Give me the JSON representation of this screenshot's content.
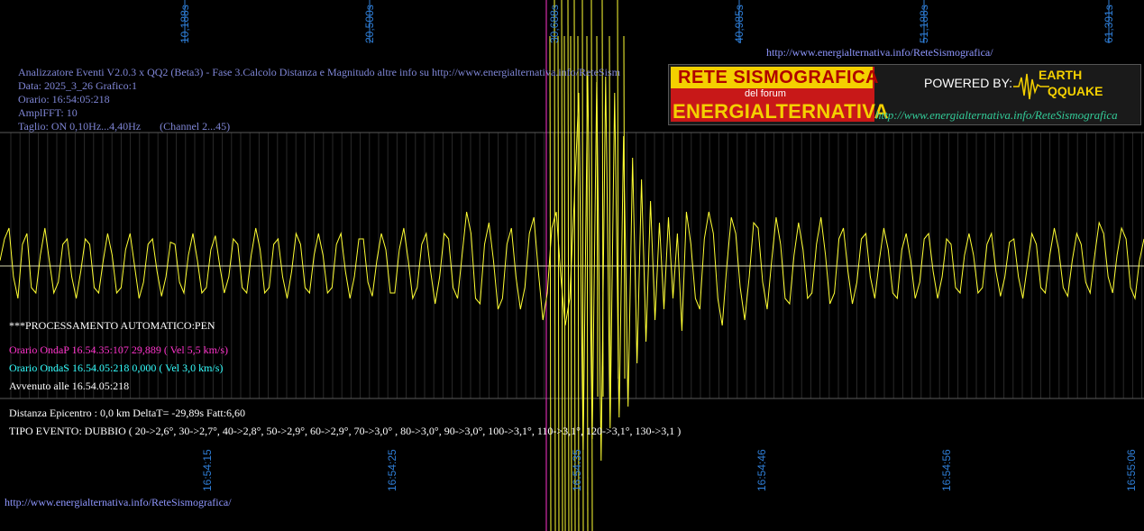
{
  "header": {
    "top_url": "http://www.energialternativa.info/ReteSismografica/",
    "title_line": "Analizzatore Eventi V2.0.3 x QQ2 (Beta3) - Fase 3.Calcolo Distanza e Magnitudo altre info su http://www.energialternativa.info/ReteSism",
    "data_line": "Data: 2025_3_26 Grafico:1",
    "orario_line": "Orario: 16:54:05:218",
    "ampl_line": "AmplFFT: 10",
    "taglio_line": "Taglio: ON 0,10Hz...4,40Hz       (Channel 2...45)"
  },
  "logo": {
    "rete": "RETE SISMOGRAFICA",
    "forum": "del forum",
    "energia": "ENERGIALTERNATIVA",
    "powered": "POWERED BY:",
    "earth": "EARTH",
    "quake": "QQUAKE",
    "url": "http://www.energialternativa.info/ReteSismografica"
  },
  "processing": {
    "status": "***PROCESSAMENTO AUTOMATICO:PEN",
    "onda_p": "Orario OndaP 16.54.35:107  29,889 ( Vel 5,5 km/s)",
    "onda_s": "Orario OndaS 16.54.05:218  0,000 ( Vel 3,0 km/s)",
    "avvenuto": "Avvenuto alle 16.54.05:218",
    "distanza": "Distanza Epicentro : 0,0 km DeltaT= -29,89s  Fatt:6,60",
    "tipo": "TIPO EVENTO: DUBBIO ( 20->2,6°, 30->2,7°, 40->2,8°, 50->2,9°, 60->2,9°, 70->3,0° , 80->3,0°, 90->3,0°, 100->3,1°, 110->3,1°, 120->3,1°, 130->3,1 )"
  },
  "footer_url": "http://www.energialternativa.info/ReteSismografica/",
  "colors": {
    "trace": "#ffff33",
    "grid": "#5a5a5a",
    "baseline": "#d8d8b0",
    "onda_p": "#ff33cc",
    "axis_label": "#2f7fd9"
  },
  "chart_data": {
    "type": "line",
    "xlabel": "",
    "ylabel": "",
    "x_top_ticks": [
      "10,188s",
      "20,500s",
      "30,688s",
      "40,985s",
      "51,188s",
      "61,391s"
    ],
    "x_bottom_ticks": [
      "16:54:15",
      "16:54:25",
      "16:54:35",
      "16:54:46",
      "16:54:56",
      "16:55:06"
    ],
    "xlim": [
      0,
      63.6
    ],
    "ylim": [
      -1,
      1
    ],
    "markers": [
      {
        "name": "OndaP",
        "x": 29.889,
        "color": "#ff33cc"
      }
    ],
    "series": [
      {
        "values": [
          0.05,
          0.25,
          0.35,
          -0.1,
          -0.3,
          0.2,
          0.3,
          -0.2,
          -0.25,
          0.1,
          0.35,
          0.05,
          -0.25,
          -0.15,
          0.2,
          0.25,
          -0.1,
          -0.3,
          -0.05,
          0.25,
          0.2,
          -0.2,
          -0.25,
          0.05,
          0.3,
          0.1,
          -0.25,
          -0.2,
          0.15,
          0.3,
          0.0,
          -0.3,
          -0.15,
          0.2,
          0.25,
          -0.05,
          -0.28,
          -0.1,
          0.22,
          0.2,
          -0.15,
          -0.25,
          0.1,
          0.3,
          0.05,
          -0.25,
          -0.2,
          0.15,
          0.28,
          0.0,
          -0.25,
          -0.1,
          0.25,
          0.2,
          -0.2,
          -0.25,
          0.1,
          0.35,
          0.15,
          -0.25,
          -0.2,
          0.2,
          0.25,
          -0.1,
          -0.3,
          -0.05,
          0.3,
          0.2,
          -0.2,
          -0.25,
          0.1,
          0.3,
          0.1,
          -0.25,
          -0.2,
          0.2,
          0.3,
          -0.05,
          -0.3,
          -0.1,
          0.25,
          0.25,
          -0.15,
          -0.28,
          0.05,
          0.3,
          0.15,
          -0.25,
          -0.25,
          0.15,
          0.35,
          0.05,
          -0.3,
          -0.2,
          0.2,
          0.3,
          -0.05,
          -0.35,
          -0.1,
          0.3,
          0.25,
          -0.2,
          -0.3,
          0.1,
          0.5,
          0.3,
          -0.3,
          -0.35,
          0.2,
          0.4,
          0.05,
          -0.4,
          -0.3,
          0.2,
          0.35,
          -0.1,
          -0.4,
          -0.2,
          0.3,
          0.45,
          -0.05,
          -0.5,
          -0.25,
          0.35,
          0.5,
          -0.1,
          -0.55,
          -0.3,
          0.6,
          1.6,
          -1.7,
          1.8,
          -1.6,
          1.7,
          -1.8,
          1.75,
          -1.5,
          1.6,
          -1.4,
          1.2,
          -1.3,
          1.0,
          -0.9,
          0.8,
          -0.7,
          0.6,
          -0.5,
          0.4,
          -0.4,
          0.45,
          -0.3,
          0.3,
          -0.6,
          0.5,
          0.2,
          -0.3,
          -0.4,
          0.25,
          0.5,
          0.3,
          -0.3,
          -0.55,
          0.0,
          0.45,
          0.3,
          -0.2,
          -0.5,
          -0.1,
          0.4,
          0.35,
          -0.15,
          -0.4,
          0.05,
          0.45,
          0.2,
          -0.3,
          -0.35,
          0.1,
          0.4,
          0.15,
          -0.3,
          -0.25,
          0.2,
          0.45,
          0.1,
          -0.35,
          -0.25,
          0.25,
          0.35,
          -0.05,
          -0.35,
          -0.15,
          0.25,
          0.3,
          -0.1,
          -0.3,
          0.05,
          0.35,
          0.15,
          -0.25,
          -0.3,
          0.15,
          0.3,
          0.05,
          -0.3,
          -0.15,
          0.25,
          0.3,
          -0.05,
          -0.3,
          -0.1,
          0.25,
          0.2,
          -0.2,
          -0.25,
          0.1,
          0.3,
          0.1,
          -0.25,
          -0.2,
          0.2,
          0.3,
          -0.05,
          -0.28,
          -0.1,
          0.22,
          0.25,
          -0.1,
          -0.3,
          0.0,
          0.3,
          0.2,
          -0.2,
          -0.25,
          0.1,
          0.35,
          0.15,
          -0.2,
          -0.28,
          0.05,
          0.3,
          0.2,
          -0.15,
          -0.25,
          0.1,
          0.4,
          0.3,
          -0.1,
          -0.25,
          0.1,
          0.35,
          0.25,
          -0.2,
          -0.3,
          0.05,
          0.25
        ]
      }
    ],
    "grid": true,
    "legend": "none"
  }
}
